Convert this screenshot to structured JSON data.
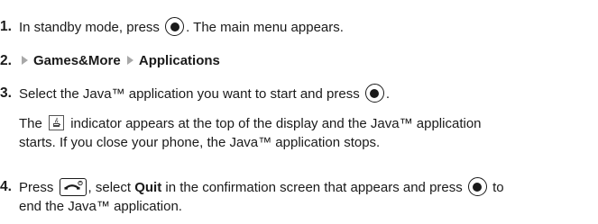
{
  "steps": [
    {
      "number": "1.",
      "lines": [
        {
          "before": "In standby mode, press",
          "after": ". The main menu appears."
        }
      ]
    },
    {
      "number": "2.",
      "path": [
        "Games&More",
        "Applications"
      ]
    },
    {
      "number": "3.",
      "lines": [
        {
          "before": "Select the Java™ application you want to start and press",
          "after": "."
        }
      ],
      "note_line1_before": "The",
      "note_line1_after": "indicator appears at the top of the display and the Java™ application",
      "note_line2": "starts. If you close your phone, the Java™ application stops."
    },
    {
      "number": "4.",
      "line1_press": "Press",
      "line1_select": ", select",
      "line1_quit": "Quit",
      "line1_rest": "in the confirmation screen that appears and press",
      "line1_to": "to",
      "line2": "end the Java™ application."
    }
  ],
  "icons": {
    "center_key": "center-select-key-icon",
    "java_indicator": "java-indicator-icon",
    "end_key": "end-power-key-icon",
    "path_arrow": "menu-path-arrow-icon"
  },
  "colors": {
    "text": "#1a1a1a",
    "arrow": "#a8a8a8"
  }
}
